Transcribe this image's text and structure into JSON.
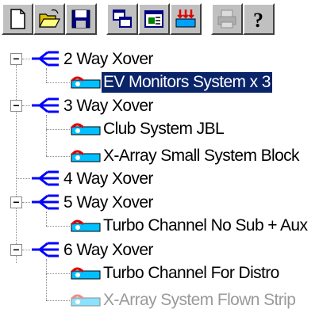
{
  "toolbar": {
    "buttons": [
      {
        "name": "new-icon"
      },
      {
        "name": "open-icon"
      },
      {
        "name": "save-icon"
      },
      {
        "name": "copy-icon"
      },
      {
        "name": "properties-icon"
      },
      {
        "name": "crossover-icon"
      },
      {
        "name": "print-icon",
        "disabled": true
      },
      {
        "name": "help-icon"
      }
    ]
  },
  "tree": {
    "groups": [
      {
        "label": "2 Way Xover",
        "children": [
          "EV Monitors System x 3"
        ]
      },
      {
        "label": "3 Way Xover",
        "children": [
          "Club System JBL",
          "X-Array Small System Block"
        ]
      },
      {
        "label": "4 Way Xover",
        "children": []
      },
      {
        "label": "5 Way Xover",
        "children": [
          "Turbo Channel No Sub + Aux"
        ]
      },
      {
        "label": "6 Way Xover",
        "children": [
          "Turbo Channel For Distro",
          "X-Array System Flown Strip"
        ]
      }
    ],
    "selected": "EV Monitors System x 3"
  },
  "colors": {
    "selection": "#0a246a",
    "xover_icon": "#0000ff",
    "system_icon": "#ff0000"
  }
}
